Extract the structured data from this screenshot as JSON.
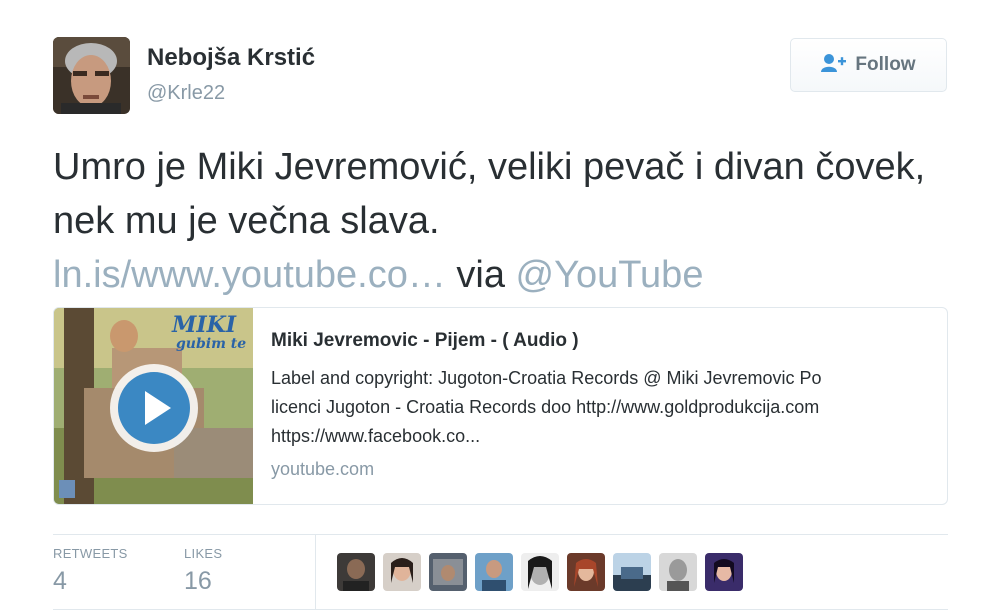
{
  "user": {
    "display_name": "Nebojša Krstić",
    "handle": "@Krle22"
  },
  "follow_button": {
    "label": "Follow",
    "icon": "add-user-icon"
  },
  "tweet": {
    "text_main": "Umro je Miki Jevremović, veliki pevač i divan čovek, nek mu je večna slava.",
    "link_text": "ln.is/www.youtube.co…",
    "via_text": "via",
    "mention": "@YouTube"
  },
  "card": {
    "title": "Miki Jevremovic - Pijem - ( Audio )",
    "description": "Label and copyright: Jugoton-Croatia Records @ Miki Jevremovic Po licenci Jugoton - Croatia Records doo http://www.goldprodukcija.com https://www.facebook.co...",
    "domain": "youtube.com",
    "thumbnail": {
      "album_title": "MIKI",
      "album_subtitle": "gubim te",
      "icon": "play-icon"
    }
  },
  "stats": {
    "retweets_label": "RETWEETS",
    "retweets_count": "4",
    "likes_label": "LIKES",
    "likes_count": "16"
  },
  "colors": {
    "link": "#9bb0bf",
    "muted": "#8899a6",
    "text": "#292f33",
    "border": "#e1e8ed",
    "play_button": "#3b88c3"
  },
  "likers": [
    {
      "avatar": "liker-avatar-1"
    },
    {
      "avatar": "liker-avatar-2"
    },
    {
      "avatar": "liker-avatar-3"
    },
    {
      "avatar": "liker-avatar-4"
    },
    {
      "avatar": "liker-avatar-5"
    },
    {
      "avatar": "liker-avatar-6"
    },
    {
      "avatar": "liker-avatar-7"
    },
    {
      "avatar": "liker-avatar-8"
    },
    {
      "avatar": "liker-avatar-9"
    }
  ]
}
